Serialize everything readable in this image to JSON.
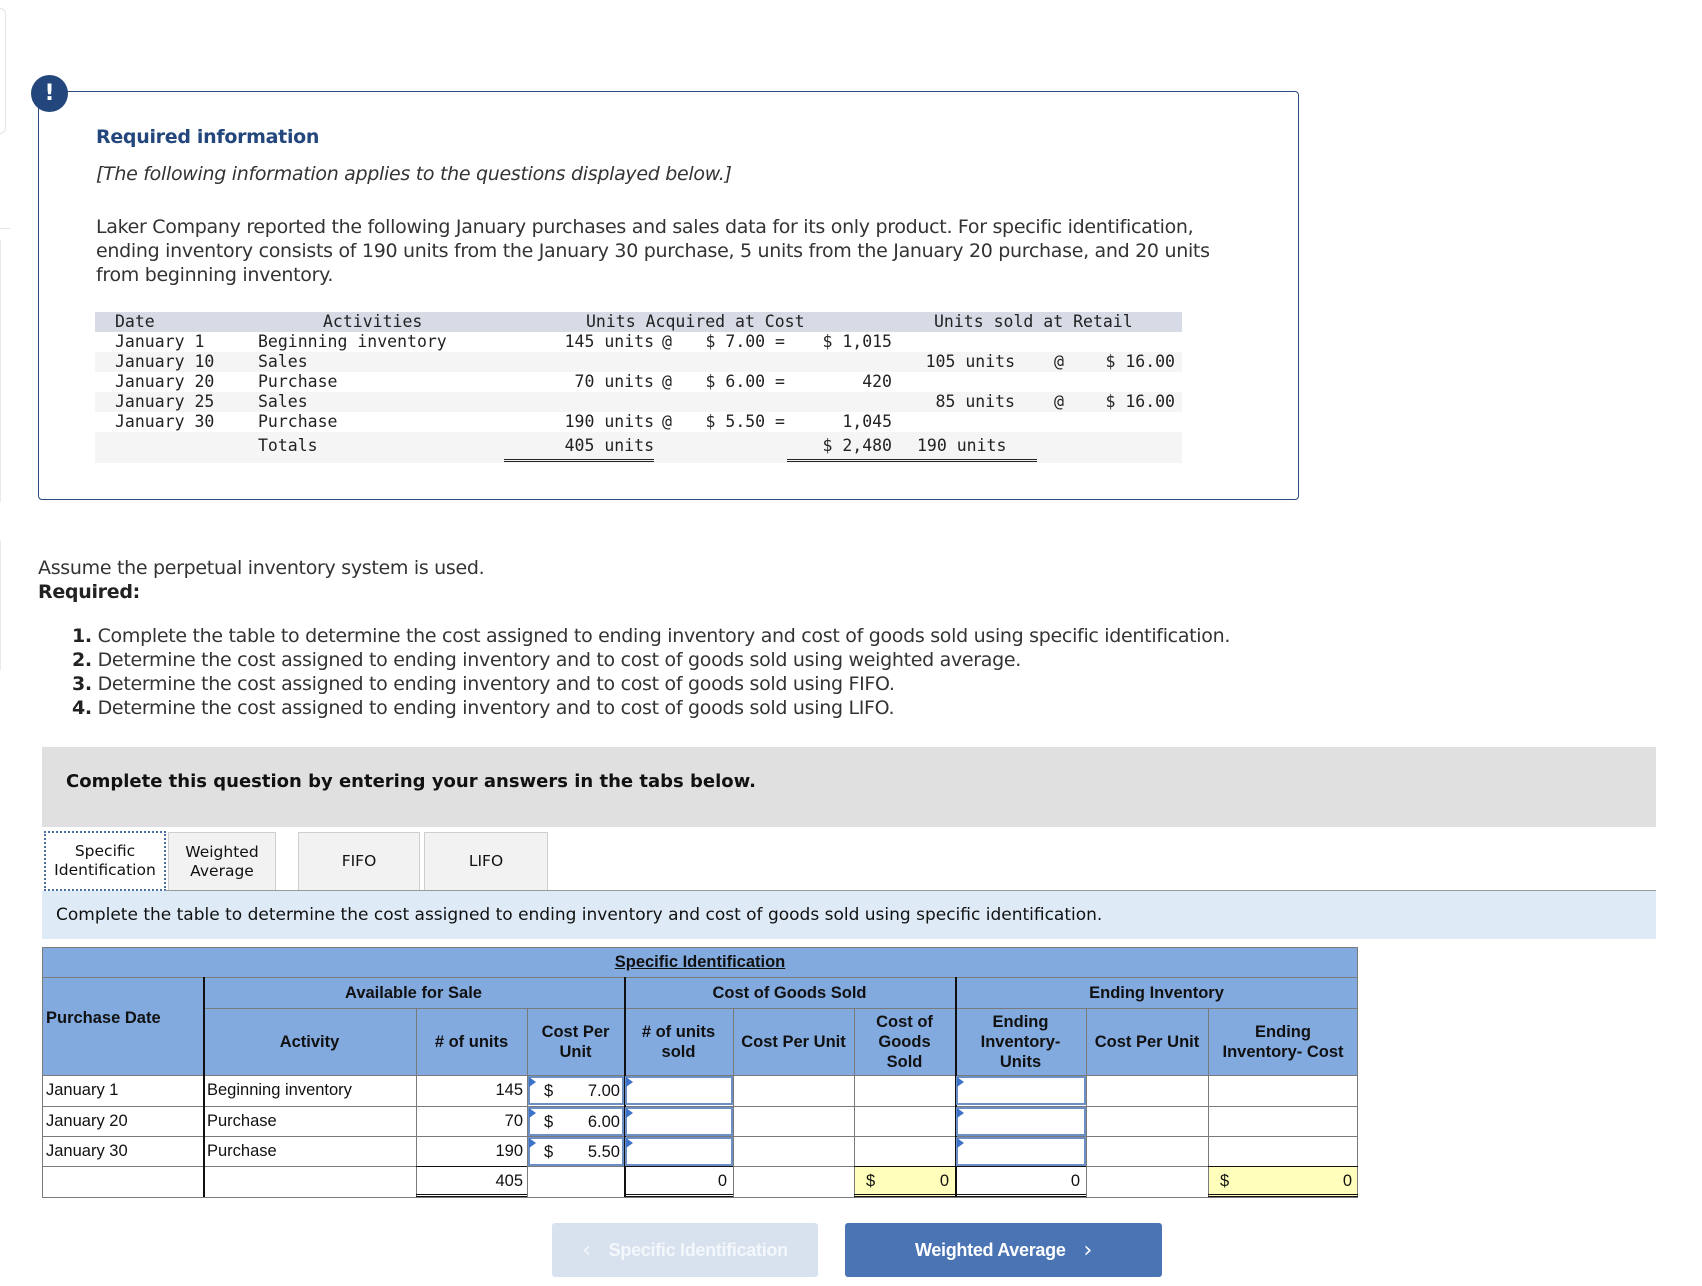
{
  "info": {
    "icon": "!",
    "title": "Required information",
    "subtitle": "[The following information applies to the questions displayed below.]",
    "body": "Laker Company reported the following January purchases and sales data for its only product. For specific identification, ending inventory consists of 190 units from the January 30 purchase, 5 units from the January 20 purchase, and 20 units from beginning inventory."
  },
  "data_table": {
    "headers": {
      "date": "Date",
      "activities": "Activities",
      "acquired": "Units Acquired at Cost",
      "sold": "Units sold at Retail"
    },
    "rows": [
      {
        "date": "January 1",
        "activity": "Beginning inventory",
        "acq_units": "145 units",
        "acq_at": "@",
        "acq_cost": "$ 7.00 =",
        "acq_total": "$ 1,015",
        "sold_units": "",
        "sold_at": "",
        "sold_price": ""
      },
      {
        "date": "January 10",
        "activity": "Sales",
        "acq_units": "",
        "acq_at": "",
        "acq_cost": "",
        "acq_total": "",
        "sold_units": "105 units",
        "sold_at": "@",
        "sold_price": "$ 16.00"
      },
      {
        "date": "January 20",
        "activity": "Purchase",
        "acq_units": "70 units",
        "acq_at": "@",
        "acq_cost": "$ 6.00 =",
        "acq_total": "420",
        "sold_units": "",
        "sold_at": "",
        "sold_price": ""
      },
      {
        "date": "January 25",
        "activity": "Sales",
        "acq_units": "",
        "acq_at": "",
        "acq_cost": "",
        "acq_total": "",
        "sold_units": "85 units",
        "sold_at": "@",
        "sold_price": "$ 16.00"
      },
      {
        "date": "January 30",
        "activity": "Purchase",
        "acq_units": "190 units",
        "acq_at": "@",
        "acq_cost": "$ 5.50 =",
        "acq_total": "1,045",
        "sold_units": "",
        "sold_at": "",
        "sold_price": ""
      }
    ],
    "totals": {
      "label": "Totals",
      "acq_units": "405 units",
      "acq_total": "$ 2,480",
      "sold_units": "190 units"
    }
  },
  "question": {
    "assume": "Assume the perpetual inventory system is used.",
    "required": "Required:",
    "items": [
      {
        "num": "1.",
        "text": "Complete the table to determine the cost assigned to ending inventory and cost of goods sold using specific identification."
      },
      {
        "num": "2.",
        "text": "Determine the cost assigned to ending inventory and to cost of goods sold using weighted average."
      },
      {
        "num": "3.",
        "text": "Determine the cost assigned to ending inventory and to cost of goods sold using FIFO."
      },
      {
        "num": "4.",
        "text": "Determine the cost assigned to ending inventory and to cost of goods sold using LIFO."
      }
    ]
  },
  "band": {
    "text": "Complete this question by entering your answers in the tabs below."
  },
  "tabs": [
    {
      "label": "Specific Identification",
      "active": true
    },
    {
      "label": "Weighted Average",
      "active": false
    },
    {
      "label": "FIFO",
      "active": false
    },
    {
      "label": "LIFO",
      "active": false
    }
  ],
  "instruction": "Complete the table to determine the cost assigned to ending inventory and cost of goods sold using specific identification.",
  "answer_table": {
    "title": "Specific Identification",
    "groups": {
      "available": "Available for Sale",
      "cogs": "Cost of Goods Sold",
      "ending": "Ending Inventory"
    },
    "columns": {
      "purchase_date": "Purchase Date",
      "activity": "Activity",
      "units": "# of units",
      "cost_per_unit": "Cost Per Unit",
      "units_sold": "# of units sold",
      "cogs_cost_per_unit": "Cost Per Unit",
      "cogs": "Cost of Goods Sold",
      "ei_units": "Ending Inventory- Units",
      "ei_cost_per_unit": "Cost Per Unit",
      "ei_cost": "Ending Inventory- Cost"
    },
    "rows": [
      {
        "date": "January 1",
        "activity": "Beginning inventory",
        "units": "145",
        "currency": "$",
        "cost": "7.00",
        "units_sold": "",
        "ei_units": ""
      },
      {
        "date": "January 20",
        "activity": "Purchase",
        "units": "70",
        "currency": "$",
        "cost": "6.00",
        "units_sold": "",
        "ei_units": ""
      },
      {
        "date": "January 30",
        "activity": "Purchase",
        "units": "190",
        "currency": "$",
        "cost": "5.50",
        "units_sold": "",
        "ei_units": ""
      }
    ],
    "totals": {
      "units": "405",
      "units_sold": "0",
      "cogs_currency": "$",
      "cogs": "0",
      "ei_units": "0",
      "ei_currency": "$",
      "ei_cost": "0"
    }
  },
  "nav": {
    "prev_label": "Specific Identification",
    "next_label": "Weighted Average",
    "prev_icon": "‹",
    "next_icon": "›"
  },
  "colors": {
    "accent": "#23477d",
    "header_blue": "#82aadf",
    "button_blue": "#4a74b4",
    "total_yellow": "#ffffbb",
    "instruction_bg": "#deebf7"
  }
}
